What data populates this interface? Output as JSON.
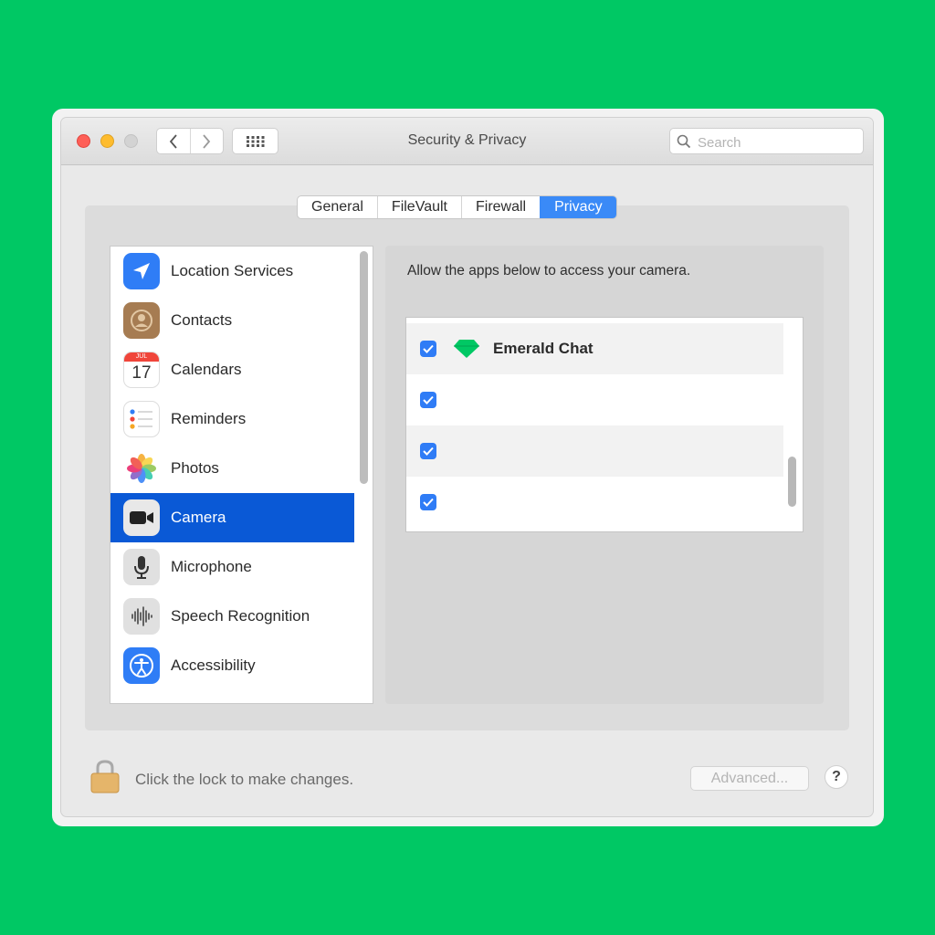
{
  "window": {
    "title": "Security & Privacy"
  },
  "search": {
    "placeholder": "Search"
  },
  "tabs": [
    {
      "label": "General"
    },
    {
      "label": "FileVault"
    },
    {
      "label": "Firewall"
    },
    {
      "label": "Privacy",
      "active": true
    }
  ],
  "sidebar": {
    "items": [
      {
        "label": "Location Services",
        "icon": "location-arrow-icon"
      },
      {
        "label": "Contacts",
        "icon": "contacts-icon"
      },
      {
        "label": "Calendars",
        "icon": "calendar-icon",
        "month": "JUL",
        "day": "17"
      },
      {
        "label": "Reminders",
        "icon": "reminders-icon"
      },
      {
        "label": "Photos",
        "icon": "photos-icon"
      },
      {
        "label": "Camera",
        "icon": "camera-icon",
        "selected": true
      },
      {
        "label": "Microphone",
        "icon": "microphone-icon"
      },
      {
        "label": "Speech Recognition",
        "icon": "speech-recognition-icon"
      },
      {
        "label": "Accessibility",
        "icon": "accessibility-icon"
      }
    ]
  },
  "main": {
    "description": "Allow the apps below to access your camera.",
    "apps": [
      {
        "name": "Emerald Chat",
        "checked": true,
        "icon": "emerald-gem-icon"
      },
      {
        "name": "",
        "checked": true
      },
      {
        "name": "",
        "checked": true
      },
      {
        "name": "",
        "checked": true
      }
    ]
  },
  "footer": {
    "lock_text": "Click the lock to make changes.",
    "advanced_label": "Advanced...",
    "help_label": "?"
  },
  "colors": {
    "background": "#00c864",
    "selection": "#0a59d6",
    "accent": "#3a8af7",
    "checkbox": "#2f7cf6"
  }
}
